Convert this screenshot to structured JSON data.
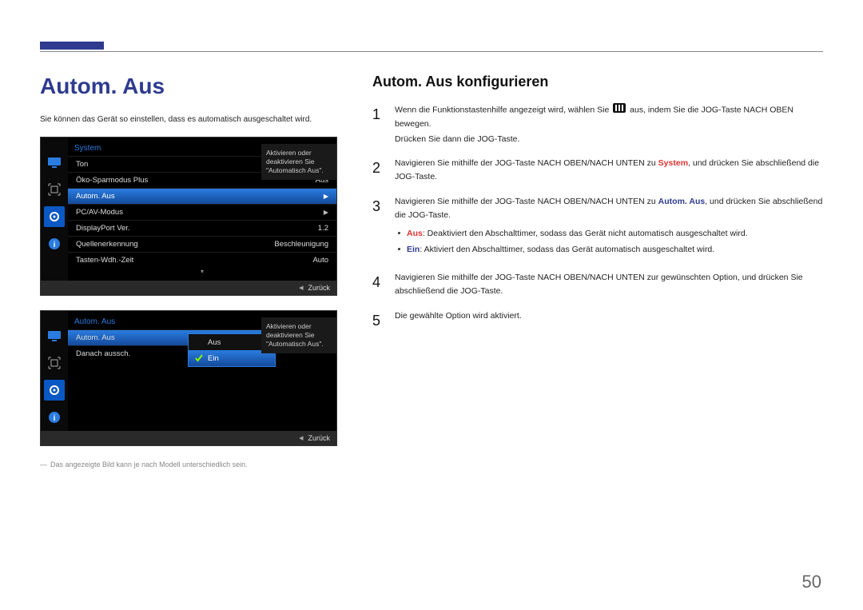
{
  "page_number": "50",
  "left": {
    "title": "Autom. Aus",
    "intro": "Sie können das Gerät so einstellen, dass es automatisch ausgeschaltet wird.",
    "footnote": "Das angezeigte Bild kann je nach Modell unterschiedlich sein."
  },
  "osd1": {
    "title": "System",
    "tooltip": "Aktivieren oder deaktivieren Sie \"Automatisch Aus\".",
    "rows": [
      {
        "label": "Ton",
        "value": "▶"
      },
      {
        "label": "Öko-Sparmodus Plus",
        "value": "Aus"
      },
      {
        "label": "Autom. Aus",
        "value": "▶",
        "selected": true
      },
      {
        "label": "PC/AV-Modus",
        "value": "▶"
      },
      {
        "label": "DisplayPort Ver.",
        "value": "1.2"
      },
      {
        "label": "Quellenerkennung",
        "value": "Beschleunigung"
      },
      {
        "label": "Tasten-Wdh.-Zeit",
        "value": "Auto"
      }
    ],
    "footer": "Zurück"
  },
  "osd2": {
    "title": "Autom. Aus",
    "tooltip": "Aktivieren oder deaktivieren Sie \"Automatisch Aus\".",
    "rows": [
      {
        "label": "Autom. Aus",
        "value": "Aus",
        "selected": true
      },
      {
        "label": "Danach aussch.",
        "value": ""
      }
    ],
    "sub_options": [
      {
        "label": "Aus",
        "checked": false
      },
      {
        "label": "Ein",
        "checked": true
      }
    ],
    "footer": "Zurück"
  },
  "right": {
    "title": "Autom. Aus konfigurieren",
    "steps": {
      "s1a": "Wenn die Funktionstastenhilfe angezeigt wird, wählen Sie ",
      "s1b": " aus, indem Sie die JOG-Taste NACH OBEN bewegen.",
      "s1c": "Drücken Sie dann die JOG-Taste.",
      "s2a": "Navigieren Sie mithilfe der JOG-Taste NACH OBEN/NACH UNTEN zu ",
      "s2_sys": "System",
      "s2b": ", und drücken Sie abschließend die JOG-Taste.",
      "s3a": "Navigieren Sie mithilfe der JOG-Taste NACH OBEN/NACH UNTEN zu ",
      "s3_menu": "Autom. Aus",
      "s3b": ", und drücken Sie abschließend die JOG-Taste.",
      "b_off_lbl": "Aus",
      "b_off": ": Deaktiviert den Abschalttimer, sodass das Gerät nicht automatisch ausgeschaltet wird.",
      "b_on_lbl": "Ein",
      "b_on": ": Aktiviert den Abschalttimer, sodass das Gerät automatisch ausgeschaltet wird.",
      "s4": "Navigieren Sie mithilfe der JOG-Taste NACH OBEN/NACH UNTEN zur gewünschten Option, und drücken Sie abschließend die JOG-Taste.",
      "s5": "Die gewählte Option wird aktiviert."
    }
  }
}
